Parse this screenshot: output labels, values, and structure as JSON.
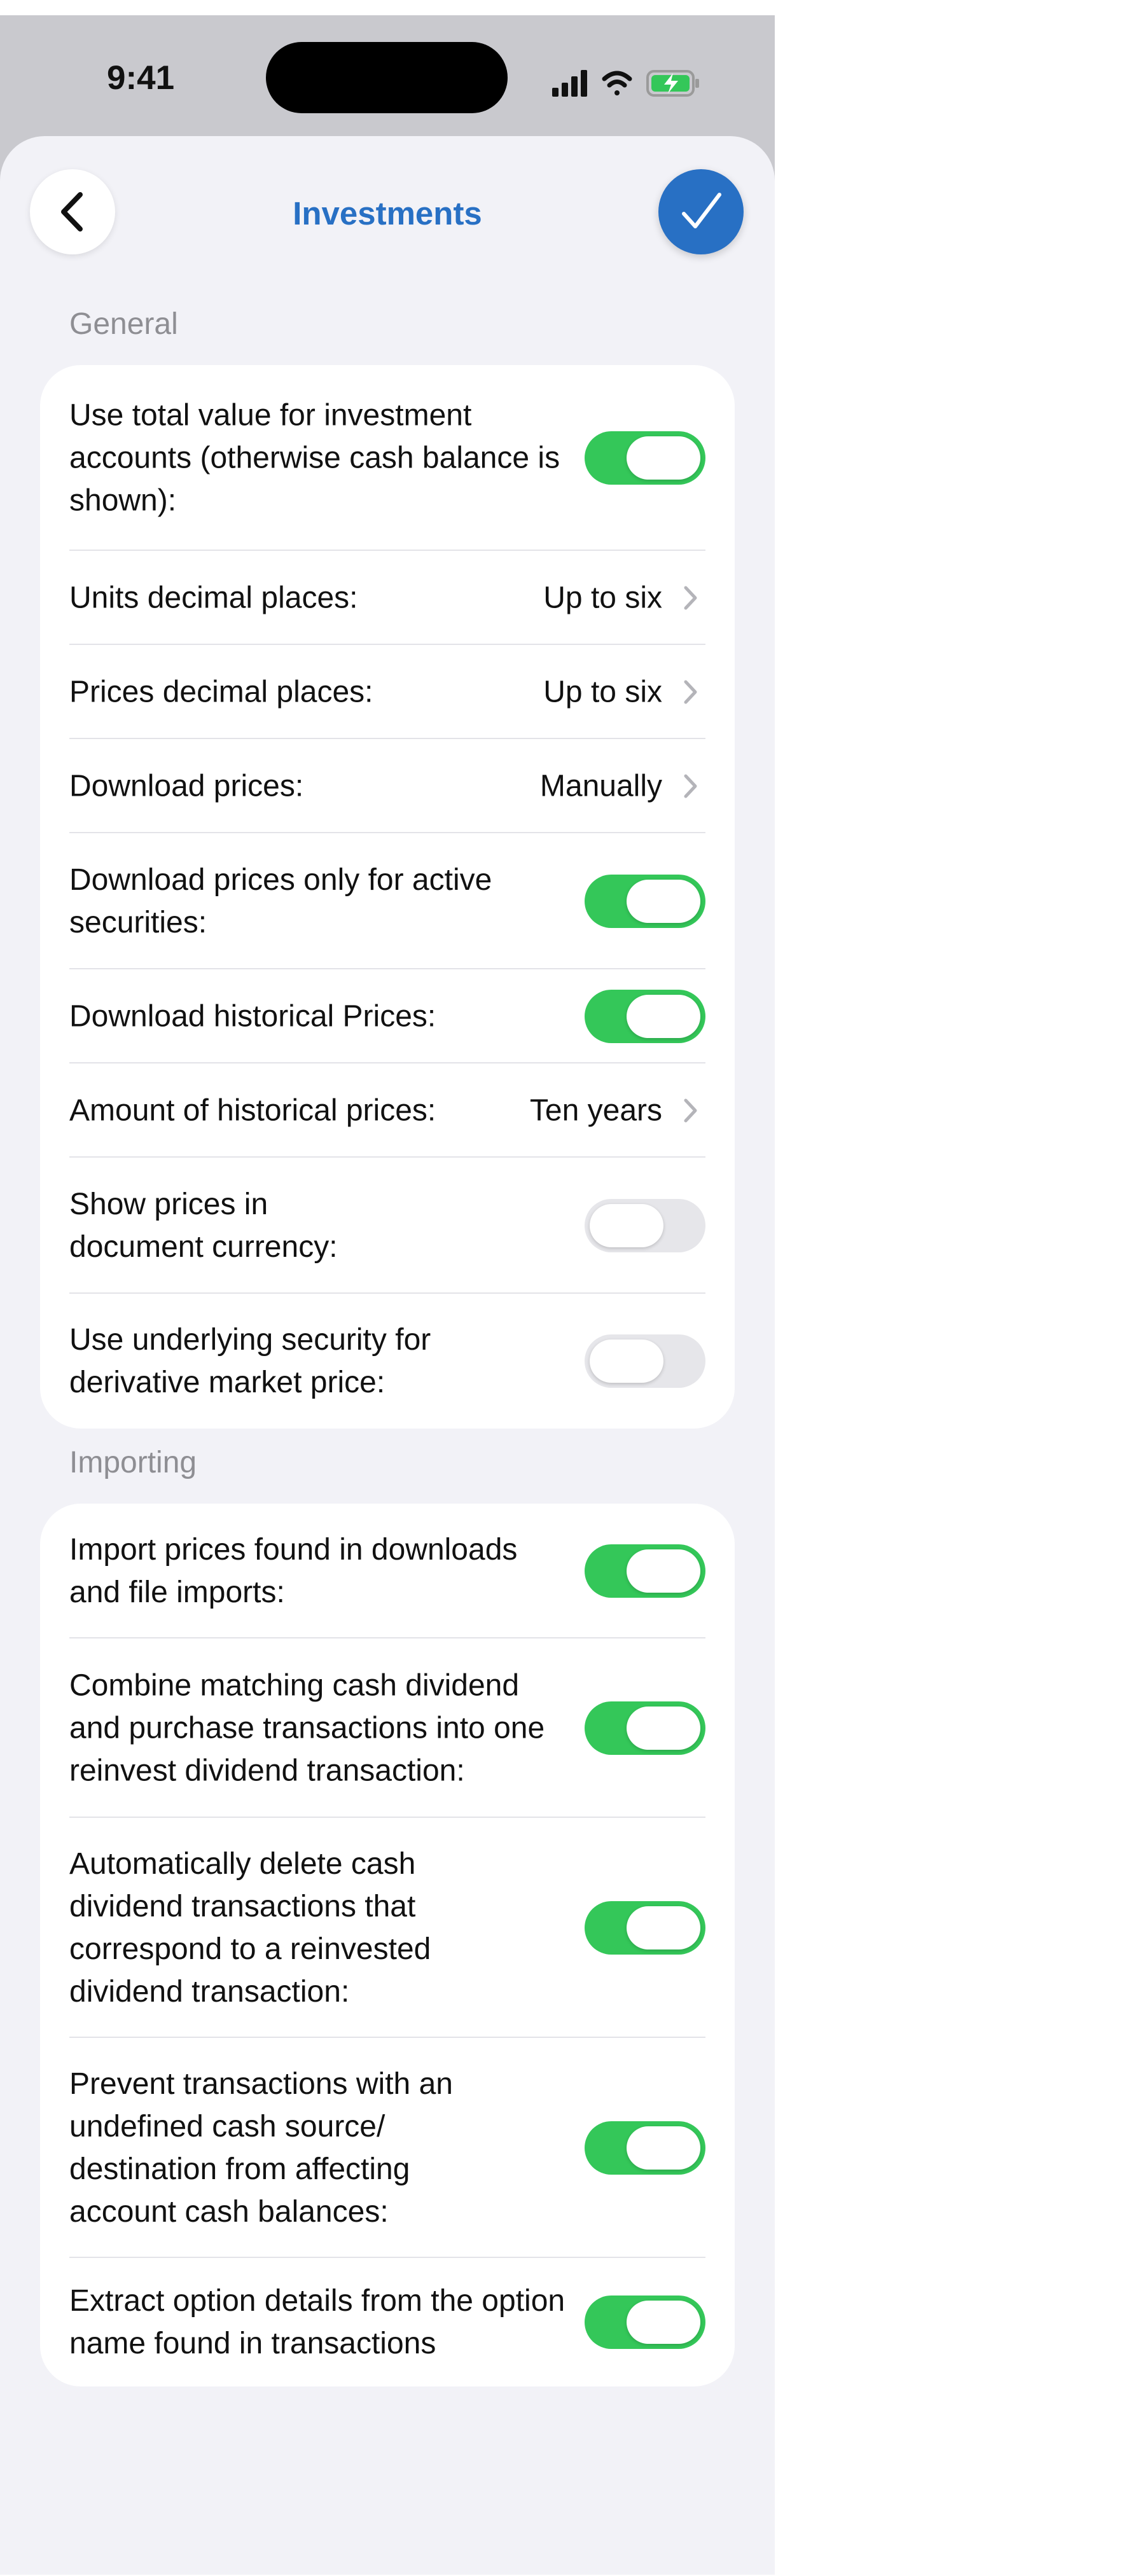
{
  "status_bar": {
    "time": "9:41"
  },
  "nav": {
    "title": "Investments",
    "back_icon": "chevron-left-icon",
    "done_icon": "checkmark-icon"
  },
  "colors": {
    "accent": "#2870c4",
    "toggle_on": "#34c759",
    "toggle_off": "#e6e6ea"
  },
  "sections": {
    "general": {
      "header": "General",
      "rows": [
        {
          "label": "Use total value for investment accounts (otherwise cash balance is shown):",
          "type": "toggle",
          "on": true
        },
        {
          "label": "Units decimal places:",
          "type": "value",
          "value": "Up to six"
        },
        {
          "label": "Prices decimal places:",
          "type": "value",
          "value": "Up to six"
        },
        {
          "label": "Download prices:",
          "type": "value",
          "value": "Manually"
        },
        {
          "label": "Download prices only for active securities:",
          "type": "toggle",
          "on": true
        },
        {
          "label": "Download historical Prices:",
          "type": "toggle",
          "on": true
        },
        {
          "label": "Amount of historical prices:",
          "type": "value",
          "value": "Ten years"
        },
        {
          "label": "Show prices in document currency:",
          "type": "toggle",
          "on": false
        },
        {
          "label": "Use underlying security for derivative market price:",
          "type": "toggle",
          "on": false
        }
      ]
    },
    "importing": {
      "header": "Importing",
      "rows": [
        {
          "label": "Import prices found in downloads and file imports:",
          "type": "toggle",
          "on": true
        },
        {
          "label": "Combine matching cash dividend and purchase transactions into one reinvest dividend transaction:",
          "type": "toggle",
          "on": true
        },
        {
          "label": "Automatically delete cash dividend transactions that correspond to a reinvested dividend transaction:",
          "type": "toggle",
          "on": true
        },
        {
          "label": "Prevent transactions with an undefined cash source/ destination from affecting account cash balances:",
          "type": "toggle",
          "on": true
        },
        {
          "label": "Extract option details from the option name found in transactions",
          "type": "toggle",
          "on": true
        }
      ]
    }
  }
}
